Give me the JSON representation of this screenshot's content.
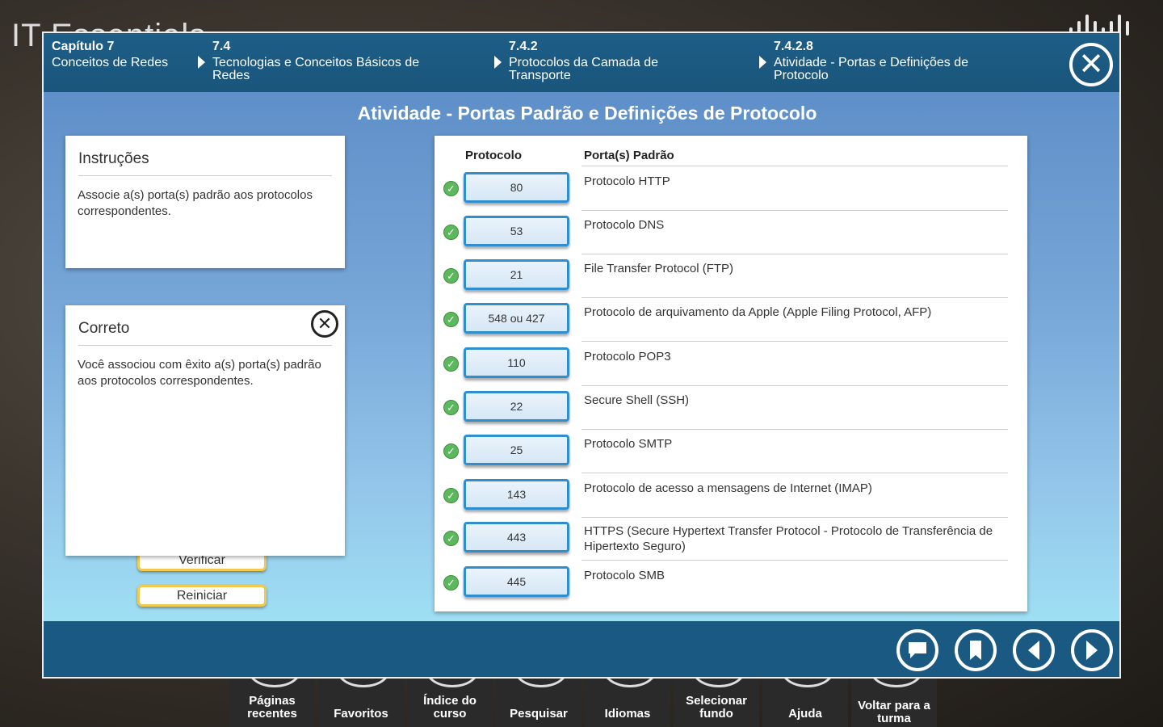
{
  "background": {
    "app_title": "IT Essentials"
  },
  "breadcrumbs": [
    {
      "num": "Capítulo 7",
      "label": "Conceitos de Redes"
    },
    {
      "num": "7.4",
      "label": "Tecnologias e Conceitos Básicos de Redes"
    },
    {
      "num": "7.4.2",
      "label": "Protocolos da Camada de Transporte"
    },
    {
      "num": "7.4.2.8",
      "label": "Atividade - Portas e Definições de Protocolo"
    }
  ],
  "content": {
    "title": "Atividade - Portas Padrão e Definições de Protocolo"
  },
  "instructions": {
    "heading": "Instruções",
    "text": "Associe a(s) porta(s) padrão aos protocolos correspondentes."
  },
  "feedback": {
    "heading": "Correto",
    "text": "Você associou com êxito a(s) porta(s) padrão aos protocolos correspondentes."
  },
  "buttons": {
    "verify": "Verificar",
    "reset": "Reiniciar"
  },
  "table": {
    "col_port": "Protocolo",
    "col_protocol": "Porta(s) Padrão",
    "rows": [
      {
        "port": "80",
        "protocol": "Protocolo HTTP"
      },
      {
        "port": "53",
        "protocol": "Protocolo DNS"
      },
      {
        "port": "21",
        "protocol": "File Transfer Protocol (FTP)"
      },
      {
        "port": "548 ou 427",
        "protocol": "Protocolo de arquivamento da Apple (Apple Filing Protocol, AFP)"
      },
      {
        "port": "110",
        "protocol": "Protocolo POP3"
      },
      {
        "port": "22",
        "protocol": "Secure Shell (SSH)"
      },
      {
        "port": "25",
        "protocol": "Protocolo SMTP"
      },
      {
        "port": "143",
        "protocol": "Protocolo de acesso a mensagens de Internet (IMAP)"
      },
      {
        "port": "443",
        "protocol": "HTTPS (Secure Hypertext Transfer Protocol  - Protocolo de Transferência de Hipertexto Seguro)"
      },
      {
        "port": "445",
        "protocol": "Protocolo SMB"
      }
    ]
  },
  "dock": [
    "Páginas recentes",
    "Favoritos",
    "Índice do curso",
    "Pesquisar",
    "Idiomas",
    "Selecionar fundo",
    "Ajuda",
    "Voltar para a turma"
  ],
  "icons": {
    "close": "close-icon",
    "check": "check-icon",
    "chat": "chat-icon",
    "bookmark": "bookmark-icon",
    "prev": "prev-arrow-icon",
    "next": "next-arrow-icon"
  },
  "colors": {
    "header_blue": "#1d5e87",
    "port_border": "#2f8fce",
    "check_green": "#5cb85c",
    "button_border": "#f2c94c"
  }
}
